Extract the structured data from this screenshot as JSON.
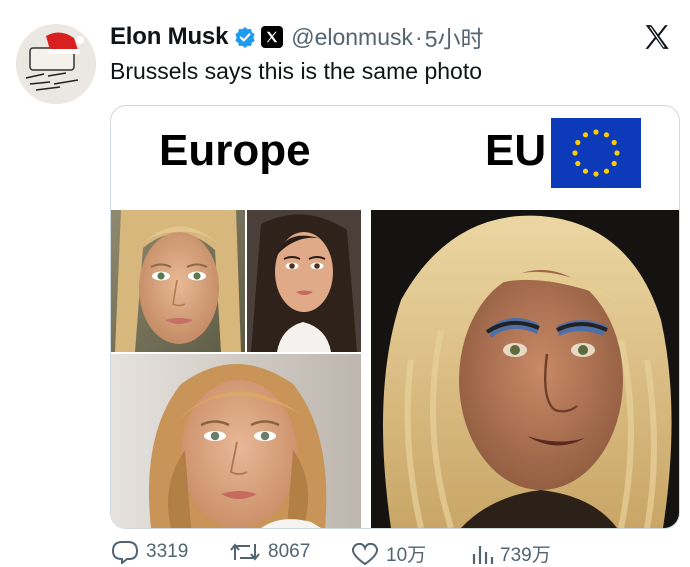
{
  "post": {
    "author_name": "Elon Musk",
    "handle": "@elonmusk",
    "separator": "·",
    "time": "5小时",
    "text": "Brussels says this is the same photo",
    "verified_icon": "verified-check-icon",
    "platform_icon": "x-logo-icon"
  },
  "image": {
    "label_left": "Europe",
    "label_right": "EU",
    "flag": "eu-flag",
    "left_photos": [
      "blonde-woman-portrait",
      "dark-haired-woman-portrait",
      "blonde-woman-closeup"
    ],
    "right_photo": "man-in-blonde-wig"
  },
  "actions": {
    "replies": "3319",
    "reposts": "8067",
    "likes": "10万",
    "views": "739万"
  },
  "colors": {
    "verified_blue": "#1d9bf0",
    "secondary_text": "#536471",
    "eu_blue": "#0d3ab8",
    "eu_star": "#ffcc00"
  }
}
